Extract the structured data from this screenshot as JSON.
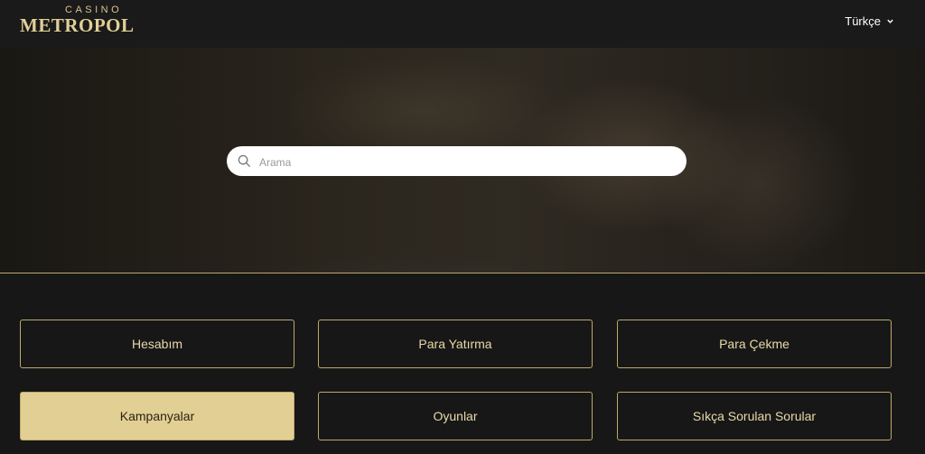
{
  "header": {
    "logo_top": "CASINO",
    "logo_main": "METROPOL",
    "language": "Türkçe"
  },
  "search": {
    "placeholder": "Arama"
  },
  "menu": [
    {
      "label": "Hesabım",
      "active": false
    },
    {
      "label": "Para Yatırma",
      "active": false
    },
    {
      "label": "Para Çekme",
      "active": false
    },
    {
      "label": "Kampanyalar",
      "active": true
    },
    {
      "label": "Oyunlar",
      "active": false
    },
    {
      "label": "Sıkça Sorulan Sorular",
      "active": false
    }
  ],
  "colors": {
    "accent": "#e2cf94",
    "border": "#bfa86a",
    "background": "#171717"
  }
}
